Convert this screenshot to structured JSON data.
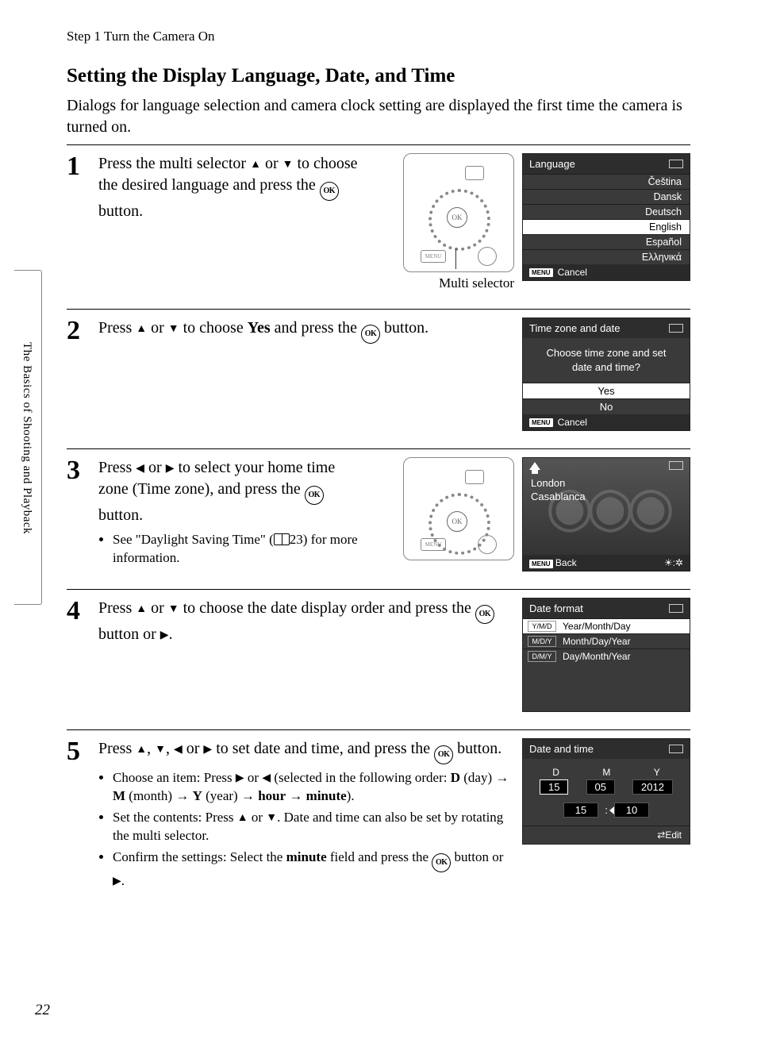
{
  "header": {
    "step_line": "Step 1 Turn the Camera On"
  },
  "title": "Setting the Display Language, Date, and Time",
  "intro": "Dialogs for language selection and camera clock setting are displayed the first time the camera is turned on.",
  "side_tab": "The Basics of Shooting and Playback",
  "page_number": "22",
  "glyph": {
    "up": "▲",
    "down": "▼",
    "left": "◀",
    "right": "▶",
    "arrow": "→",
    "colon": ":"
  },
  "labels": {
    "ok": "OK",
    "menu": "MENU",
    "multi_selector": "Multi selector",
    "book_page": "23"
  },
  "step1": {
    "num": "1",
    "t1": "Press the multi selector ",
    "t2": " or ",
    "t3": " to choose the desired language and press the ",
    "t4": " button."
  },
  "lcd1": {
    "title": "Language",
    "items": [
      "Čeština",
      "Dansk",
      "Deutsch",
      "English",
      "Español",
      "Ελληνικά"
    ],
    "selected": "English",
    "cancel": "Cancel"
  },
  "step2": {
    "num": "2",
    "t1": "Press ",
    "t2": " or ",
    "t3": " to choose ",
    "yes": "Yes",
    "t4": " and press the ",
    "t5": " button."
  },
  "lcd2": {
    "title": "Time zone and date",
    "msg": "Choose time zone and set date and time?",
    "yes": "Yes",
    "no": "No",
    "cancel": "Cancel"
  },
  "step3": {
    "num": "3",
    "t1": "Press ",
    "t2": " or ",
    "t3": " to select your home time zone (Time zone), and press the ",
    "t4": " button.",
    "sub1a": "See \"Daylight Saving Time\" (",
    "sub1b": ") for more information."
  },
  "lcd3": {
    "city1": "London",
    "city2": "Casablanca",
    "back": "Back"
  },
  "step4": {
    "num": "4",
    "t1": "Press ",
    "t2": " or ",
    "t3": " to choose the date display order and press the ",
    "t4": " button or ",
    "t5": "."
  },
  "lcd4": {
    "title": "Date format",
    "rows": [
      {
        "code": "Y/M/D",
        "label": "Year/Month/Day"
      },
      {
        "code": "M/D/Y",
        "label": "Month/Day/Year"
      },
      {
        "code": "D/M/Y",
        "label": "Day/Month/Year"
      }
    ],
    "selected": "Y/M/D"
  },
  "step5": {
    "num": "5",
    "t1": "Press ",
    "t2": ", ",
    "t3": ", ",
    "t4": " or ",
    "t5": " to set date and time, and press the ",
    "t6": " button.",
    "b1a": "Choose an item: Press ",
    "b1b": " or ",
    "b1c": " (selected in the following order: ",
    "D": "D",
    "b1d": " (day) ",
    "M": "M",
    "b1e": " (month) ",
    "Y": "Y",
    "b1f": " (year) ",
    "hour": "hour",
    "b1g": " ",
    "minute": "minute",
    "b1h": ").",
    "b2a": "Set the contents: Press ",
    "b2b": " or ",
    "b2c": ". Date and time can also be set by rotating the multi selector.",
    "b3a": "Confirm the settings: Select the ",
    "b3b": " field and press the ",
    "b3c": " button or ",
    "b3d": "."
  },
  "lcd5": {
    "title": "Date and time",
    "lD": "D",
    "lM": "M",
    "lY": "Y",
    "vD": "15",
    "vM": "05",
    "vY": "2012",
    "tH": "15",
    "tM": "10",
    "edit": "Edit"
  }
}
